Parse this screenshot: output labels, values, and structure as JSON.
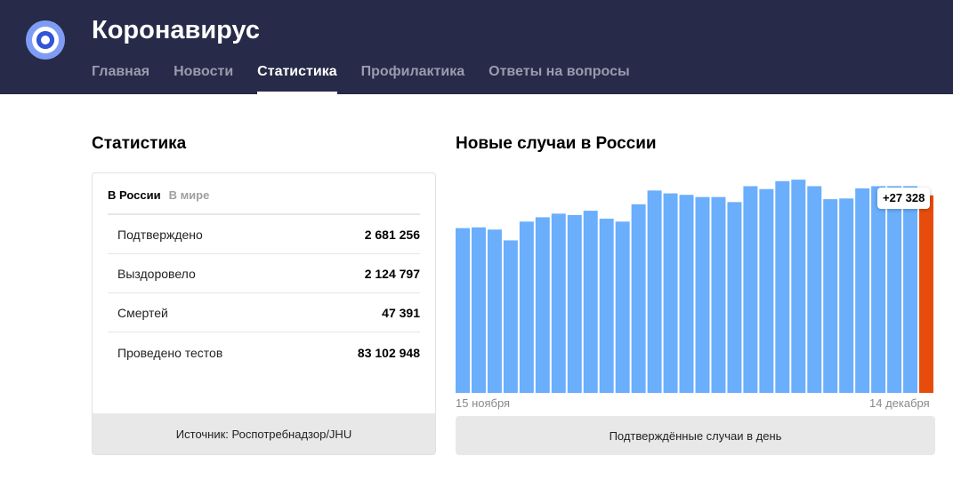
{
  "site": {
    "title": "Коронавирус",
    "logo_icon": "virus-logo-icon"
  },
  "nav": [
    {
      "label": "Главная",
      "active": false
    },
    {
      "label": "Новости",
      "active": false
    },
    {
      "label": "Статистика",
      "active": true
    },
    {
      "label": "Профилактика",
      "active": false
    },
    {
      "label": "Ответы на вопросы",
      "active": false
    }
  ],
  "stats": {
    "title": "Статистика",
    "tabs": [
      {
        "label": "В России",
        "active": true
      },
      {
        "label": "В мире",
        "active": false
      }
    ],
    "rows": [
      {
        "label": "Подтверждено",
        "value": "2 681 256"
      },
      {
        "label": "Выздоровело",
        "value": "2 124 797"
      },
      {
        "label": "Смертей",
        "value": "47 391"
      },
      {
        "label": "Проведено тестов",
        "value": "83 102 948"
      }
    ],
    "source": "Источник: Роспотребнадзор/JHU"
  },
  "chart": {
    "title": "Новые случаи в России",
    "start_label": "15 ноября",
    "end_label": "14 декабря",
    "highlight_label": "+27 328",
    "footer": "Подтверждённые случаи в день"
  },
  "chart_data": {
    "type": "bar",
    "x_start": "15 ноября",
    "x_end": "14 декабря",
    "values": [
      22800,
      22900,
      22600,
      21100,
      23700,
      24300,
      24800,
      24600,
      25200,
      24100,
      23700,
      26100,
      28000,
      27600,
      27400,
      27100,
      27100,
      26400,
      28600,
      28200,
      29300,
      29500,
      28600,
      26800,
      26900,
      28300,
      28600,
      28600,
      28600,
      27328
    ],
    "highlight_index": 29,
    "ylim": [
      0,
      30500
    ],
    "colors": {
      "bar": "#6aaefc",
      "highlight": "#e74c0c"
    }
  }
}
